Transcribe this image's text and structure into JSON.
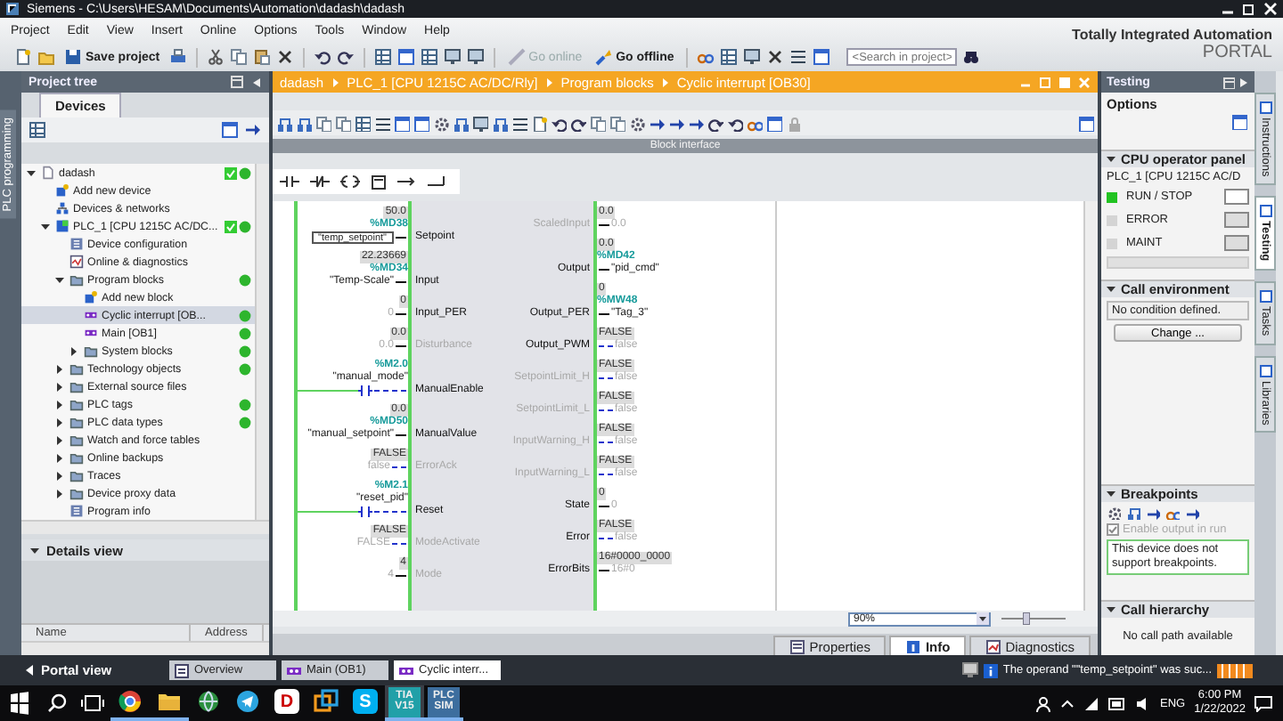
{
  "window": {
    "title": "Siemens  -  C:\\Users\\HESAM\\Documents\\Automation\\dadash\\dadash"
  },
  "menu": [
    "Project",
    "Edit",
    "View",
    "Insert",
    "Online",
    "Options",
    "Tools",
    "Window",
    "Help"
  ],
  "brand": {
    "line1": "Totally Integrated Automation",
    "line2": "PORTAL"
  },
  "toolbar": {
    "save_label": "Save project",
    "go_online": {
      "label": "Go online",
      "disabled": true
    },
    "go_offline": {
      "label": "Go offline",
      "disabled": false
    },
    "search": {
      "placeholder": "<Search in project>"
    }
  },
  "side_tab": {
    "label": "PLC programming"
  },
  "project_tree": {
    "title": "Project tree",
    "tabs": [
      {
        "label": "Devices",
        "selected": true
      }
    ],
    "items": [
      {
        "label": "dadash",
        "kind": "project",
        "expanded": true,
        "selected": false,
        "check": true,
        "ok": true,
        "children": [
          {
            "label": "Add new device",
            "kind": "add",
            "selected": false,
            "check": false,
            "ok": false
          },
          {
            "label": "Devices & networks",
            "kind": "network",
            "selected": false,
            "check": false,
            "ok": false
          },
          {
            "label": "PLC_1 [CPU 1215C AC/DC...",
            "kind": "plc",
            "expanded": true,
            "selected": false,
            "check": true,
            "ok": true,
            "children": [
              {
                "label": "Device configuration",
                "kind": "config",
                "selected": false,
                "check": false,
                "ok": false
              },
              {
                "label": "Online & diagnostics",
                "kind": "diag",
                "selected": false,
                "check": false,
                "ok": false
              },
              {
                "label": "Program blocks",
                "kind": "folder",
                "expanded": true,
                "selected": false,
                "check": false,
                "ok": true,
                "children": [
                  {
                    "label": "Add new block",
                    "kind": "add",
                    "selected": false,
                    "check": false,
                    "ok": false
                  },
                  {
                    "label": "Cyclic interrupt [OB...",
                    "kind": "block",
                    "selected": true,
                    "check": false,
                    "ok": true
                  },
                  {
                    "label": "Main [OB1]",
                    "kind": "block",
                    "selected": false,
                    "check": false,
                    "ok": true
                  },
                  {
                    "label": "System blocks",
                    "kind": "folder",
                    "expanded": false,
                    "selected": false,
                    "check": false,
                    "ok": true
                  }
                ]
              },
              {
                "label": "Technology objects",
                "kind": "folder",
                "expanded": false,
                "selected": false,
                "check": false,
                "ok": true
              },
              {
                "label": "External source files",
                "kind": "folder",
                "expanded": false,
                "selected": false,
                "check": false,
                "ok": false
              },
              {
                "label": "PLC tags",
                "kind": "folder",
                "expanded": false,
                "selected": false,
                "check": false,
                "ok": true
              },
              {
                "label": "PLC data types",
                "kind": "folder",
                "expanded": false,
                "selected": false,
                "check": false,
                "ok": true
              },
              {
                "label": "Watch and force tables",
                "kind": "folder",
                "expanded": false,
                "selected": false,
                "check": false,
                "ok": false
              },
              {
                "label": "Online backups",
                "kind": "folder",
                "expanded": false,
                "selected": false,
                "check": false,
                "ok": false
              },
              {
                "label": "Traces",
                "kind": "folder",
                "expanded": false,
                "selected": false,
                "check": false,
                "ok": false
              },
              {
                "label": "Device proxy data",
                "kind": "folder",
                "expanded": false,
                "selected": false,
                "check": false,
                "ok": false
              },
              {
                "label": "Program info",
                "kind": "config",
                "selected": false,
                "check": false,
                "ok": false
              }
            ]
          }
        ]
      }
    ],
    "details": {
      "title": "Details view",
      "expanded": true,
      "columns": [
        "Name",
        "Address"
      ]
    }
  },
  "editor": {
    "breadcrumb": [
      "dadash",
      "PLC_1 [CPU 1215C AC/DC/Rly]",
      "Program blocks",
      "Cyclic interrupt [OB30]"
    ],
    "interface_bar": "Block interface",
    "zoom": "90%",
    "zoom_slider": {
      "level": 0.4
    },
    "inputs": [
      {
        "name": "Setpoint",
        "kind": "real",
        "connected": true,
        "monitor": "50.0",
        "address": "%MD38",
        "operand": "\"temp_setpoint\"",
        "editing": true
      },
      {
        "name": "Input",
        "kind": "real",
        "connected": true,
        "monitor": "22.23669",
        "address": "%MD34",
        "operand": "\"Temp-Scale\"",
        "editing": false
      },
      {
        "name": "Input_PER",
        "kind": "real",
        "connected": true,
        "monitor": "0",
        "default": "0"
      },
      {
        "name": "Disturbance",
        "kind": "real",
        "connected": false,
        "monitor": "0.0",
        "default": "0.0"
      },
      {
        "name": "ManualEnable",
        "kind": "contact",
        "connected": true,
        "address": "%M2.0",
        "operand": "\"manual_mode\"",
        "editing": false
      },
      {
        "name": "ManualValue",
        "kind": "real",
        "connected": true,
        "monitor": "0.0",
        "address": "%MD50",
        "operand": "\"manual_setpoint\"",
        "editing": false
      },
      {
        "name": "ErrorAck",
        "kind": "bool",
        "connected": false,
        "monitor": "FALSE",
        "default": "false"
      },
      {
        "name": "Reset",
        "kind": "contact",
        "connected": true,
        "address": "%M2.1",
        "operand": "\"reset_pid\"",
        "editing": false
      },
      {
        "name": "ModeActivate",
        "kind": "bool",
        "connected": false,
        "monitor": "FALSE",
        "default": "FALSE"
      },
      {
        "name": "Mode",
        "kind": "real",
        "connected": false,
        "monitor": "4",
        "default": "4"
      }
    ],
    "outputs": [
      {
        "name": "ScaledInput",
        "kind": "real",
        "connected": false,
        "monitor": "0.0",
        "default": "0.0"
      },
      {
        "name": "Output",
        "kind": "real",
        "connected": true,
        "monitor": "0.0",
        "address": "%MD42",
        "operand": "\"pid_cmd\"",
        "editing": false
      },
      {
        "name": "Output_PER",
        "kind": "real",
        "connected": true,
        "monitor": "0",
        "address": "%MW48",
        "operand": "\"Tag_3\"",
        "editing": false
      },
      {
        "name": "Output_PWM",
        "kind": "bool",
        "connected": true,
        "monitor": "FALSE",
        "default": "false"
      },
      {
        "name": "SetpointLimit_H",
        "kind": "bool",
        "connected": false,
        "monitor": "FALSE",
        "default": "false"
      },
      {
        "name": "SetpointLimit_L",
        "kind": "bool",
        "connected": false,
        "monitor": "FALSE",
        "default": "false"
      },
      {
        "name": "InputWarning_H",
        "kind": "bool",
        "connected": false,
        "monitor": "FALSE",
        "default": "false"
      },
      {
        "name": "InputWarning_L",
        "kind": "bool",
        "connected": false,
        "monitor": "FALSE",
        "default": "false"
      },
      {
        "name": "State",
        "kind": "real",
        "connected": true,
        "monitor": "0",
        "default": "0"
      },
      {
        "name": "Error",
        "kind": "bool",
        "connected": true,
        "monitor": "FALSE",
        "default": "false"
      },
      {
        "name": "ErrorBits",
        "kind": "real",
        "connected": true,
        "monitor": "16#0000_0000",
        "default": "16#0"
      }
    ]
  },
  "inspector_tabs": [
    {
      "label": "Properties",
      "selected": false
    },
    {
      "label": "Info",
      "selected": true
    },
    {
      "label": "Diagnostics",
      "selected": false
    }
  ],
  "testing": {
    "title": "Testing",
    "options_title": "Options",
    "cpu_panel": {
      "title": "CPU operator panel",
      "expanded": true,
      "device": "PLC_1 [CPU 1215C AC/D",
      "leds": [
        {
          "label": "RUN / STOP",
          "on": true
        },
        {
          "label": "ERROR",
          "on": false
        },
        {
          "label": "MAINT",
          "on": false
        }
      ]
    },
    "call_environment": {
      "title": "Call environment",
      "expanded": true,
      "value": "No condition defined.",
      "button": "Change ..."
    },
    "breakpoints": {
      "title": "Breakpoints",
      "expanded": true,
      "enable_output": {
        "label": "Enable output in run",
        "checked": true,
        "disabled": true
      },
      "note": "This device does not support breakpoints."
    },
    "call_hierarchy": {
      "title": "Call hierarchy",
      "expanded": true,
      "note": "No call path available"
    }
  },
  "right_tabs": [
    {
      "label": "Instructions",
      "selected": false
    },
    {
      "label": "Testing",
      "selected": true
    },
    {
      "label": "Tasks",
      "selected": false
    },
    {
      "label": "Libraries",
      "selected": false
    }
  ],
  "status_bar": {
    "portal": "Portal view",
    "tabs": [
      {
        "label": "Overview",
        "kind": "overview",
        "selected": false
      },
      {
        "label": "Main (OB1)",
        "kind": "block",
        "selected": false
      },
      {
        "label": "Cyclic interr...",
        "kind": "block",
        "selected": true
      }
    ],
    "message": "The operand \"\"temp_setpoint\" was suc..."
  },
  "taskbar": {
    "apps": [
      {
        "kind": "browser",
        "running": true,
        "selected": false
      },
      {
        "kind": "folder",
        "running": true,
        "selected": false
      },
      {
        "kind": "globe",
        "running": false,
        "selected": false
      },
      {
        "kind": "plane",
        "running": false,
        "selected": false
      },
      {
        "kind": "letter",
        "label": "D",
        "running": false,
        "selected": false
      },
      {
        "kind": "squares",
        "running": false,
        "selected": false
      },
      {
        "kind": "letter",
        "label": "S",
        "running": false,
        "selected": false
      },
      {
        "kind": "tile",
        "label": "TIA",
        "sub": "V15",
        "running": true,
        "selected": true
      },
      {
        "kind": "tile",
        "label": "PLC",
        "sub": "SIM",
        "running": true,
        "selected": false
      }
    ],
    "language": "ENG",
    "time": "6:00 PM",
    "date": "1/22/2022"
  }
}
